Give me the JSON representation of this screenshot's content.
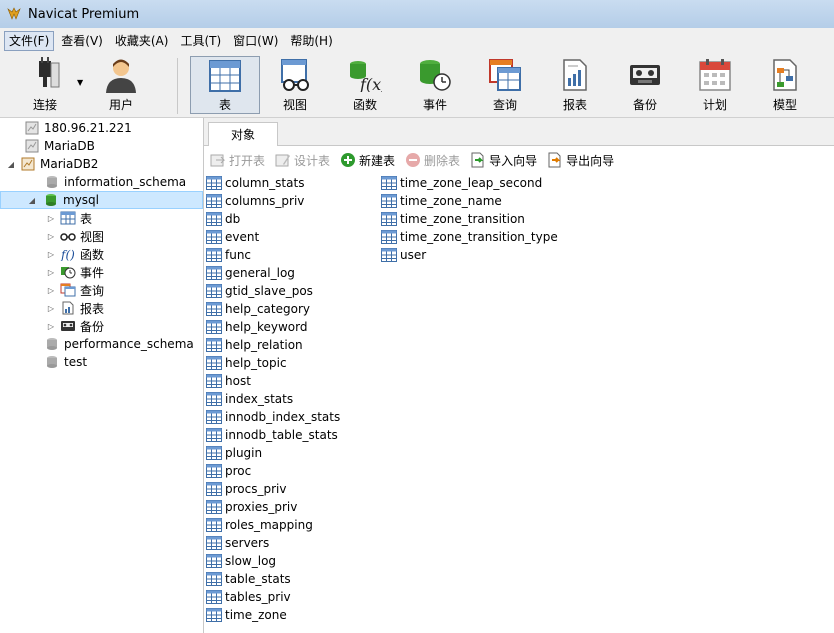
{
  "window": {
    "title": "Navicat Premium"
  },
  "menu": [
    {
      "label": "文件(F)",
      "active": true
    },
    {
      "label": "查看(V)"
    },
    {
      "label": "收藏夹(A)"
    },
    {
      "label": "工具(T)"
    },
    {
      "label": "窗口(W)"
    },
    {
      "label": "帮助(H)"
    }
  ],
  "toolbar": {
    "connect": "连接",
    "user": "用户",
    "table": "表",
    "view": "视图",
    "function": "函数",
    "event": "事件",
    "query": "查询",
    "report": "报表",
    "backup": "备份",
    "schedule": "计划",
    "model": "模型"
  },
  "tree": {
    "connections": [
      "180.96.21.221",
      "MariaDB",
      "MariaDB2"
    ],
    "databases": [
      "information_schema",
      "mysql",
      "performance_schema",
      "test"
    ],
    "mysql_children": [
      "表",
      "视图",
      "函数",
      "事件",
      "查询",
      "报表",
      "备份"
    ]
  },
  "tabs": {
    "objects": "对象"
  },
  "actions": {
    "open_table": "打开表",
    "design_table": "设计表",
    "new_table": "新建表",
    "delete_table": "删除表",
    "import_wizard": "导入向导",
    "export_wizard": "导出向导"
  },
  "tables_col1": [
    "column_stats",
    "columns_priv",
    "db",
    "event",
    "func",
    "general_log",
    "gtid_slave_pos",
    "help_category",
    "help_keyword",
    "help_relation",
    "help_topic",
    "host",
    "index_stats",
    "innodb_index_stats",
    "innodb_table_stats",
    "plugin",
    "proc",
    "procs_priv",
    "proxies_priv",
    "roles_mapping",
    "servers",
    "slow_log",
    "table_stats",
    "tables_priv",
    "time_zone"
  ],
  "tables_col2": [
    "time_zone_leap_second",
    "time_zone_name",
    "time_zone_transition",
    "time_zone_transition_type",
    "user"
  ],
  "colors": {
    "selection": "#cde8ff",
    "db_green": "#3a9a2e",
    "table_icon": "#3f6fa8"
  }
}
